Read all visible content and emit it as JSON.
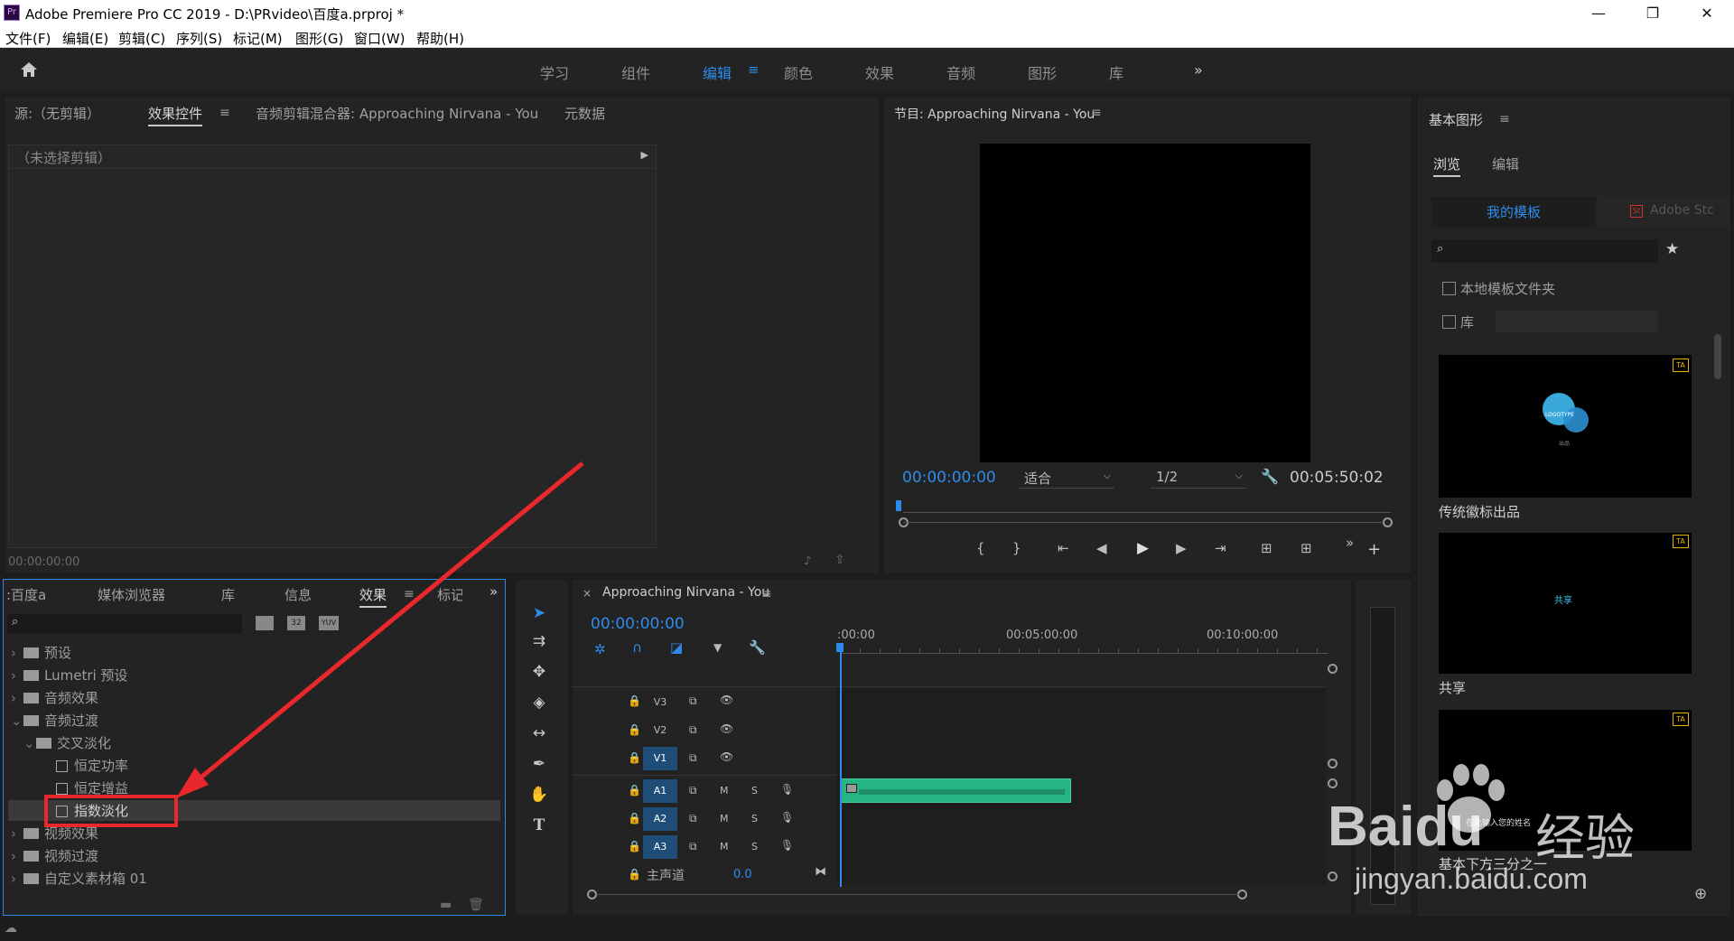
{
  "app": {
    "title": "Adobe Premiere Pro CC 2019 - D:\\PRvideo\\百度a.prproj *",
    "icon_label": "Pr",
    "min": "—",
    "max": "❐",
    "close": "✕"
  },
  "menubar": [
    "文件(F)",
    "编辑(E)",
    "剪辑(C)",
    "序列(S)",
    "标记(M)",
    "图形(G)",
    "窗口(W)",
    "帮助(H)"
  ],
  "workspaces": [
    "学习",
    "组件",
    "编辑",
    "颜色",
    "效果",
    "音频",
    "图形",
    "库"
  ],
  "workspaces_active": "编辑",
  "source_panel": {
    "tabs": [
      "源:（无剪辑）",
      "效果控件",
      "音频剪辑混合器: Approaching Nirvana - You",
      "元数据"
    ],
    "no_clip": "（未选择剪辑）",
    "timecode": "00:00:00:00"
  },
  "program_panel": {
    "title": "节目: Approaching Nirvana - You",
    "timecode": "00:00:00:00",
    "fit": "适合",
    "resolution": "1/2",
    "duration": "00:05:50:02"
  },
  "project_panel": {
    "tabs": [
      ":百度a",
      "媒体浏览器",
      "库",
      "信息",
      "效果",
      "标记"
    ],
    "badges": [
      "",
      "32",
      "YUV"
    ],
    "items": [
      {
        "label": "预设",
        "level": 0,
        "open": false,
        "kind": "preset"
      },
      {
        "label": "Lumetri 预设",
        "level": 0,
        "open": false,
        "kind": "preset"
      },
      {
        "label": "音频效果",
        "level": 0,
        "open": false,
        "kind": "folder"
      },
      {
        "label": "音频过渡",
        "level": 0,
        "open": true,
        "kind": "folder"
      },
      {
        "label": "交叉淡化",
        "level": 1,
        "open": true,
        "kind": "folder"
      },
      {
        "label": "恒定功率",
        "level": 2,
        "kind": "fx"
      },
      {
        "label": "恒定增益",
        "level": 2,
        "kind": "fx"
      },
      {
        "label": "指数淡化",
        "level": 2,
        "kind": "fx",
        "selected": true
      },
      {
        "label": "视频效果",
        "level": 0,
        "open": false,
        "kind": "folder"
      },
      {
        "label": "视频过渡",
        "level": 0,
        "open": false,
        "kind": "folder"
      },
      {
        "label": "自定义素材箱 01",
        "level": 0,
        "open": false,
        "kind": "folder"
      }
    ]
  },
  "timeline": {
    "title": "Approaching Nirvana - You",
    "timecode": "00:00:00:00",
    "ruler": [
      ":00:00",
      "00:05:00:00",
      "00:10:00:00"
    ],
    "tracks": [
      "V3",
      "V2",
      "V1",
      "A1",
      "A2",
      "A3"
    ],
    "master": "主声道",
    "master_value": "0.0",
    "mute": "M",
    "solo": "S"
  },
  "essential_graphics": {
    "title": "基本图形",
    "tabs": [
      "浏览",
      "编辑"
    ],
    "subtabs": [
      "我的模板",
      "Adobe Stc"
    ],
    "local_folder": "本地模板文件夹",
    "library": "库",
    "templates": [
      {
        "name": "传统徽标出品",
        "inner": "LOGOTYPE",
        "sub": "出品"
      },
      {
        "name": "共享",
        "inner": "共享"
      },
      {
        "name": "基本下方三分之一",
        "inner": "在此输入您的姓名"
      }
    ]
  },
  "watermark": {
    "brand": "Baidu",
    "cn": "经验",
    "url": "jingyan.baidu.com"
  },
  "colors": {
    "accent": "#2d8ceb",
    "highlight_box": "#e8282d",
    "audio_clip": "#25b585"
  }
}
